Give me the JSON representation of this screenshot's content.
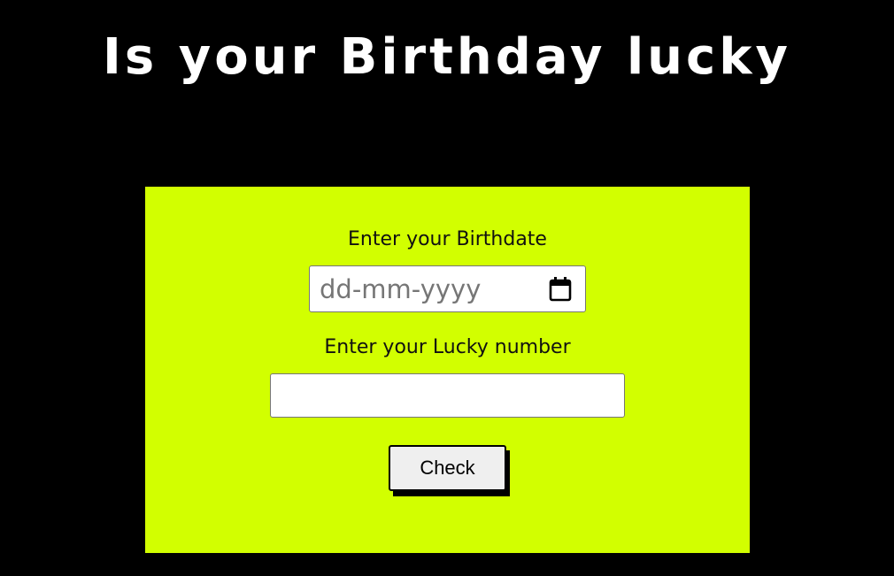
{
  "page": {
    "title": "Is your Birthday lucky"
  },
  "form": {
    "birthdate_label": "Enter your Birthdate",
    "birthdate_placeholder": "dd-mm-yyyy",
    "birthdate_value": "",
    "lucky_label": "Enter your Lucky number",
    "lucky_value": "",
    "check_label": "Check",
    "calendar_icon": "calendar-icon"
  },
  "colors": {
    "background": "#000000",
    "card": "#d2ff00",
    "title": "#ffffff"
  }
}
